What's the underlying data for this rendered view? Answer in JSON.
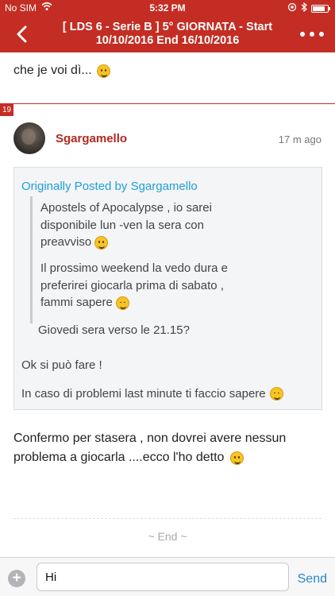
{
  "status_bar": {
    "carrier": "No SIM",
    "time": "5:32 PM",
    "battery_level": 0.85
  },
  "nav": {
    "title_line1": "[ LDS 6 - Serie B ] 5° GIORNATA - Start",
    "title_line2": "10/10/2016 End 16/10/2016"
  },
  "previous_post": {
    "text": "che je voi dì..."
  },
  "post": {
    "number": "19",
    "username": "Sgargamello",
    "timestamp": "17 m ago",
    "quote": {
      "header": "Originally Posted by Sgargamello",
      "nested": [
        {
          "lines": [
            "Apostels of Apocalypse , io sarei",
            "disponibile lun -ven la sera con",
            "preavviso"
          ]
        },
        {
          "lines": [
            "Il prossimo weekend la vedo dura e",
            "preferirei giocarla prima di sabato ,",
            "fammi sapere"
          ]
        }
      ],
      "reply_line": "Giovedi sera verso le 21.15?",
      "line2": "Ok si può fare !",
      "line3": "In caso di problemi last minute ti faccio sapere"
    },
    "body_line1": "Confermo per stasera , non dovrei avere nessun",
    "body_line2": "problema a giocarla ....ecco l'ho detto"
  },
  "end_label": "~ End ~",
  "input": {
    "value": "Hi",
    "send_label": "Send",
    "add_label": "+"
  },
  "icons": {
    "back": "chevron-left-icon",
    "more": "more-dots-icon",
    "wifi": "wifi-icon",
    "bluetooth": "bluetooth-icon",
    "lock_rotation": "rotation-lock-icon",
    "emoji_grin": "grinning-face-emoji",
    "emoji_wink": "winking-face-emoji"
  },
  "colors": {
    "brand": "#c42d23",
    "username": "#b02a22",
    "quote_header": "#1ea0d8",
    "send": "#2a86c8"
  }
}
